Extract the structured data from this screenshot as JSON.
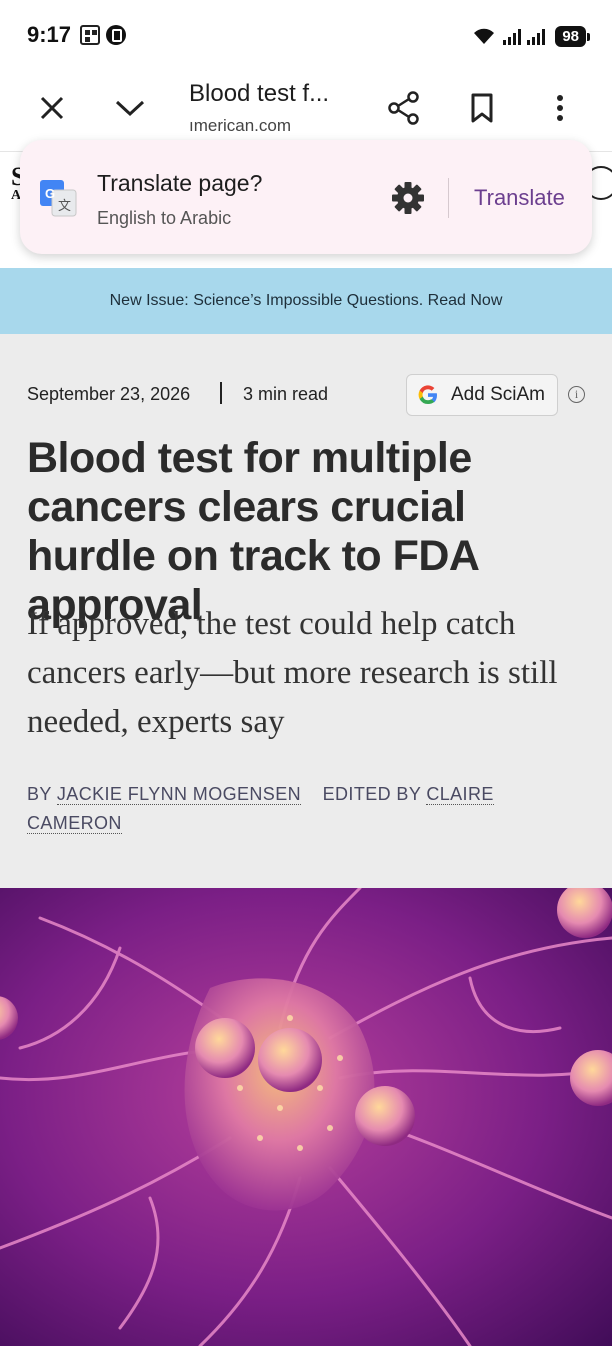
{
  "status_bar": {
    "time": "9:17",
    "battery": "98"
  },
  "toolbar": {
    "title": "Blood test f...",
    "url": "ımerican.com"
  },
  "translate_popup": {
    "title": "Translate page?",
    "subtitle": "English to Arabic",
    "action": "Translate"
  },
  "page_header": {
    "logo_letters": [
      "S",
      "A"
    ]
  },
  "banner": {
    "text": "New Issue: Science’s Impossible Questions. Read Now"
  },
  "article": {
    "date": "September 23, 2026",
    "read_time": "3 min read",
    "add_button": "Add SciAm",
    "headline": "Blood test for multiple cancers clears crucial hurdle on track to FDA approval",
    "dek": "If approved, the test could help catch cancers early—but more research is still needed, experts say",
    "byline": {
      "by_prefix": "BY",
      "author": "JACKIE FLYNN MOGENSEN",
      "edited_prefix": "EDITED BY",
      "editor": "CLAIRE CAMERON"
    }
  },
  "colors": {
    "banner_bg": "#a8d8ec",
    "article_bg": "#ececec",
    "popup_bg": "#fdf1f6",
    "translate_accent": "#6c3f8f"
  }
}
